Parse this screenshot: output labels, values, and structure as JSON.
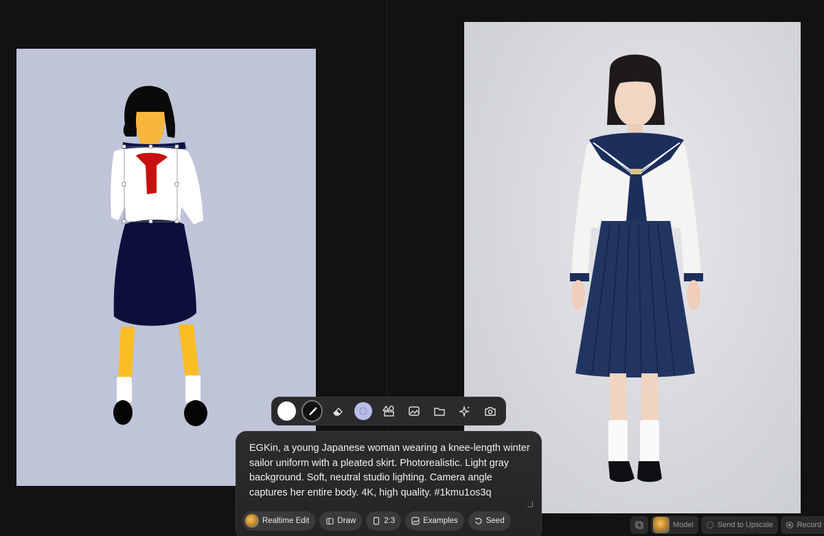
{
  "prompt": {
    "text": "EGKin, a young Japanese woman wearing a knee-length winter sailor uniform with a pleated skirt. Photorealistic. Light gray background. Soft, neutral studio lighting. Camera angle captures her entire body. 4K, high quality. #1kmu1os3q"
  },
  "actions": {
    "realtime_edit": "Realtime Edit",
    "draw": "Draw",
    "ratio": "2:3",
    "examples": "Examples",
    "seed": "Seed"
  },
  "bottombar": {
    "model": "Model",
    "send_to_upscale": "Send to Upscale",
    "record": "Record"
  },
  "toolbar": {
    "tools": [
      "color-swatch",
      "brush-icon",
      "eraser-icon",
      "smudge-icon",
      "shapes-icon",
      "image-icon",
      "folder-icon",
      "sparkle-icon",
      "camera-icon"
    ]
  },
  "colors": {
    "canvas_bg": "#bfc4d9",
    "panel_bg": "#2c2c2e",
    "chip_bg": "#3a3a3c",
    "app_bg": "#121212"
  }
}
